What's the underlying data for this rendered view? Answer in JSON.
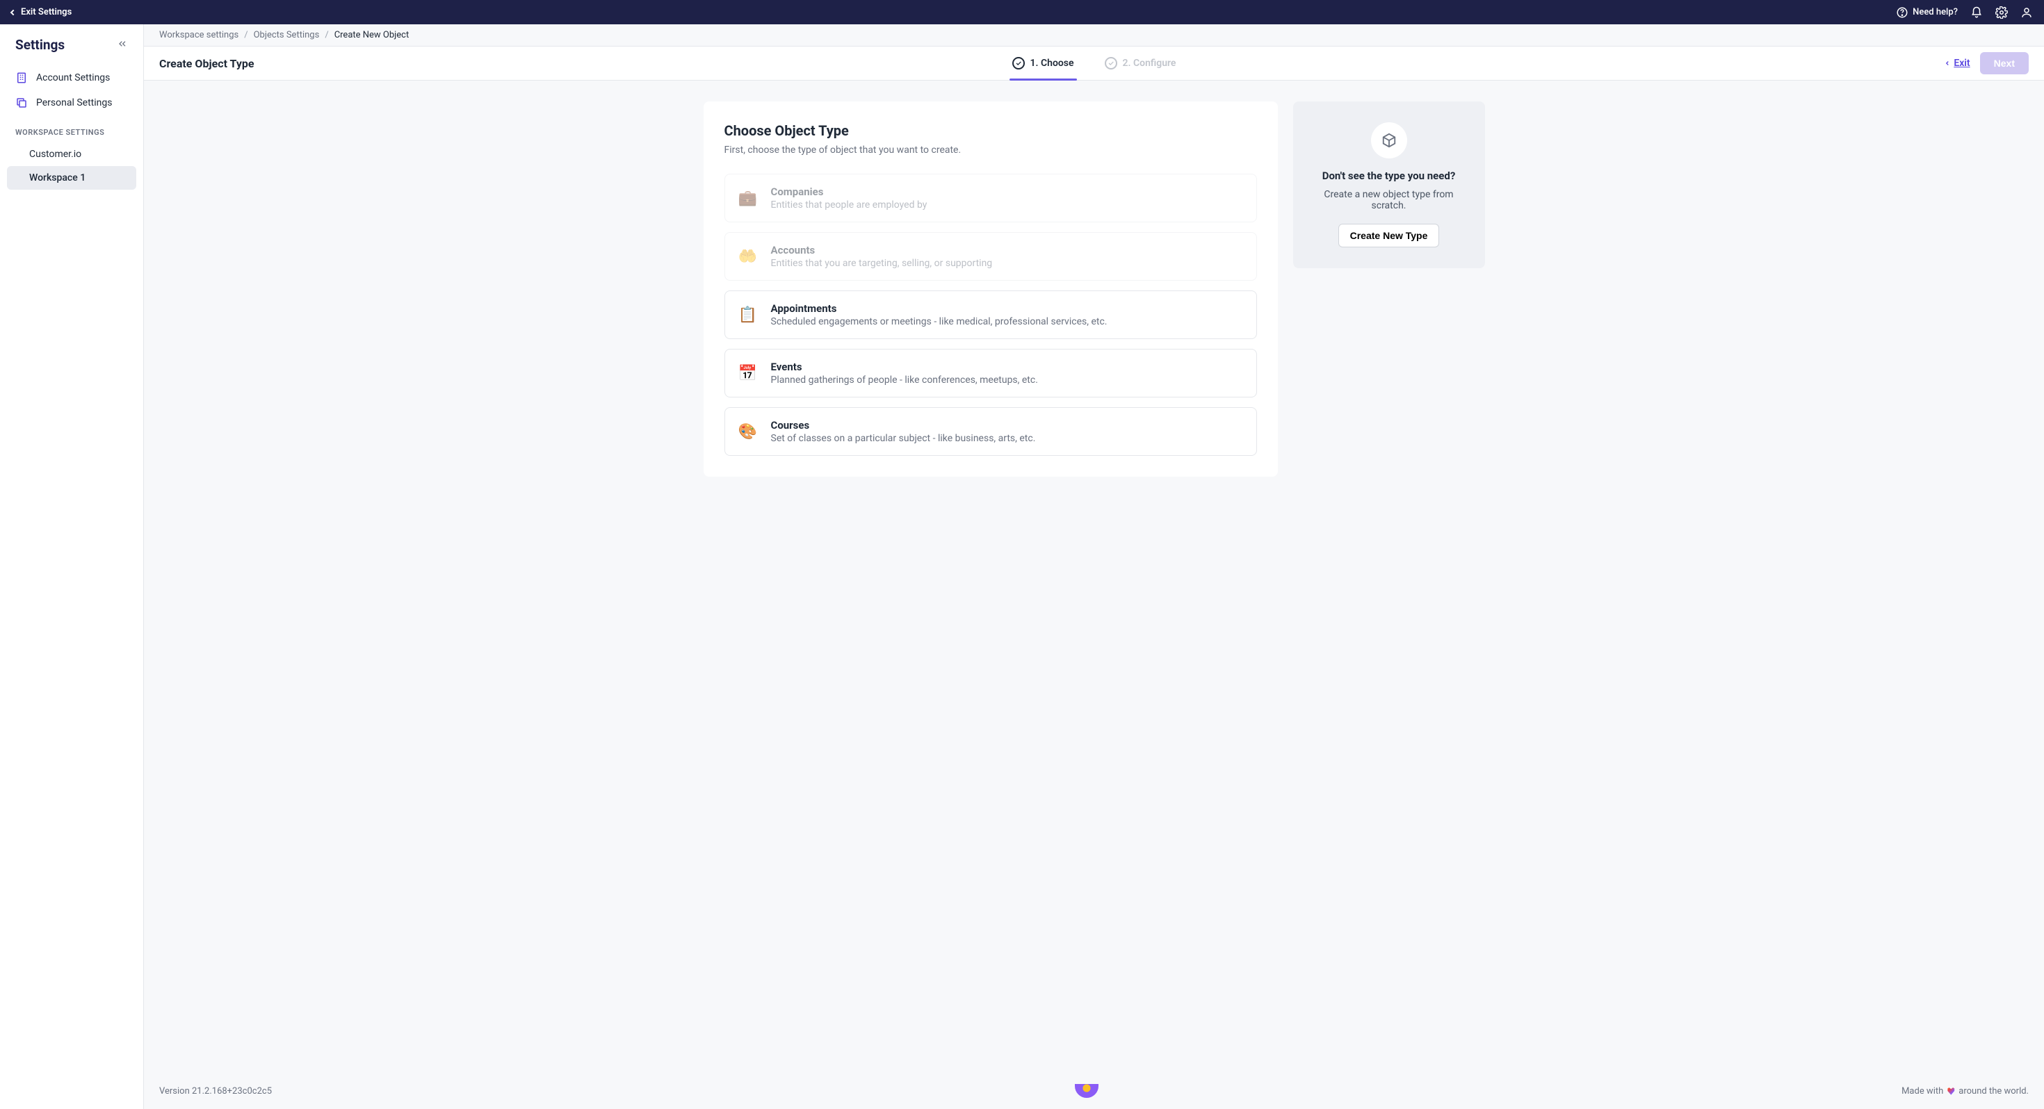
{
  "topbar": {
    "exit_label": "Exit Settings",
    "help_label": "Need help?"
  },
  "sidebar": {
    "title": "Settings",
    "items": [
      {
        "label": "Account Settings"
      },
      {
        "label": "Personal Settings"
      }
    ],
    "section_label": "Workspace Settings",
    "workspaces": [
      {
        "label": "Customer.io",
        "active": false
      },
      {
        "label": "Workspace 1",
        "active": true
      }
    ]
  },
  "breadcrumb": {
    "items": [
      "Workspace settings",
      "Objects Settings",
      "Create New Object"
    ]
  },
  "wizard": {
    "title": "Create Object Type",
    "steps": [
      {
        "label": "1. Choose",
        "active": true
      },
      {
        "label": "2. Configure",
        "active": false
      }
    ],
    "exit_label": "Exit",
    "next_label": "Next"
  },
  "content": {
    "heading": "Choose Object Type",
    "subtitle": "First, choose the type of object that you want to create.",
    "types": [
      {
        "icon": "💼",
        "name": "Companies",
        "desc": "Entities that people are employed by",
        "disabled": true
      },
      {
        "icon": "🤲",
        "name": "Accounts",
        "desc": "Entities that you are targeting, selling, or supporting",
        "disabled": true
      },
      {
        "icon": "📋",
        "name": "Appointments",
        "desc": "Scheduled engagements or meetings - like medical, professional services, etc.",
        "disabled": false
      },
      {
        "icon": "📅",
        "name": "Events",
        "desc": "Planned gatherings of people - like conferences, meetups, etc.",
        "disabled": false
      },
      {
        "icon": "🎨",
        "name": "Courses",
        "desc": "Set of classes on a particular subject - like business, arts, etc.",
        "disabled": false
      }
    ]
  },
  "side_panel": {
    "heading": "Don't see the type you need?",
    "body": "Create a new object type from scratch.",
    "button": "Create New Type"
  },
  "footer": {
    "version": "Version 21.2.168+23c0c2c5",
    "made_prefix": "Made with",
    "made_suffix": "around the world."
  }
}
